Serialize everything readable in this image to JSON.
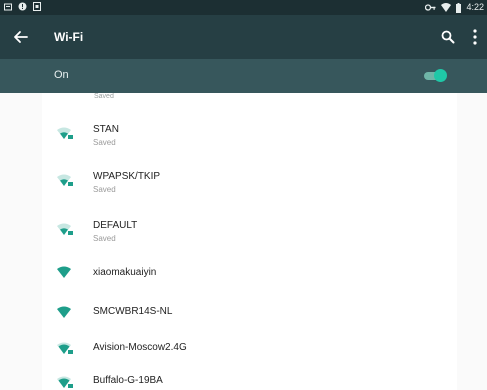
{
  "status_bar": {
    "time": "4:22",
    "left_icons": [
      "notification-icon",
      "alert-icon",
      "sd-card-icon"
    ],
    "right_icons": [
      "vpn-key-icon",
      "wifi-signal-icon",
      "battery-icon"
    ]
  },
  "toolbar": {
    "title": "Wi-Fi",
    "back_icon": "arrow-back-icon",
    "search_icon": "search-icon",
    "menu_icon": "overflow-menu-icon",
    "background": "#263f44"
  },
  "toggle": {
    "label": "On",
    "state": true,
    "accent": "#1fc8a7",
    "background": "#37575c"
  },
  "list": {
    "partial_top_subtitle": "Saved",
    "networks": [
      {
        "name": "STAN",
        "subtitle": "Saved",
        "secured": true
      },
      {
        "name": "WPAPSK/TKIP",
        "subtitle": "Saved",
        "secured": true
      },
      {
        "name": "DEFAULT",
        "subtitle": "Saved",
        "secured": true
      },
      {
        "name": "xiaomakuaiyin",
        "subtitle": "",
        "secured": false
      },
      {
        "name": "SMCWBR14S-NL",
        "subtitle": "",
        "secured": false
      },
      {
        "name": "Avision-Moscow2.4G",
        "subtitle": "",
        "secured": true
      },
      {
        "name": "Buffalo-G-19BA",
        "subtitle": "",
        "secured": true
      }
    ],
    "icon_color": "#1e9e8a"
  }
}
